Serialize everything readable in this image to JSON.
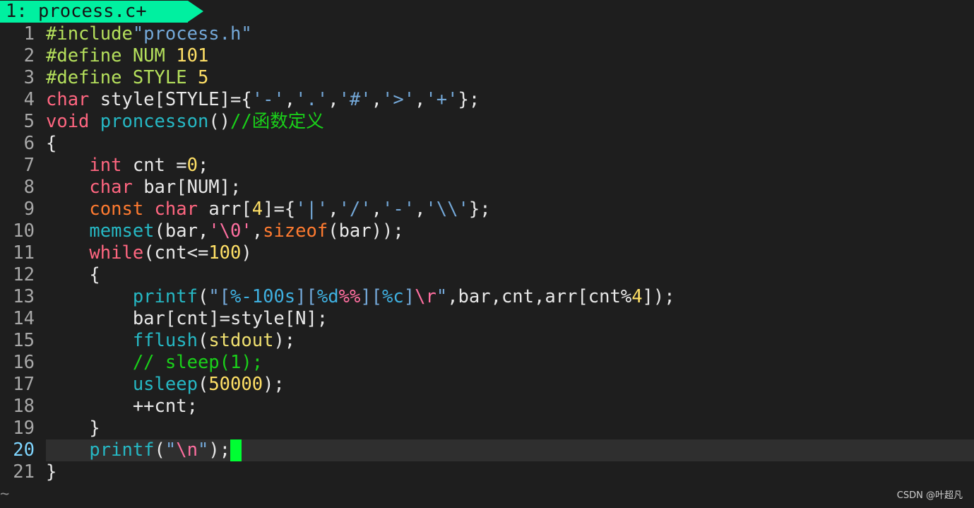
{
  "tab": {
    "label": "1: process.c+"
  },
  "lines": [
    {
      "n": "1",
      "tokens": [
        [
          "pre",
          "#include"
        ],
        [
          "str",
          "\"process.h\""
        ]
      ]
    },
    {
      "n": "2",
      "tokens": [
        [
          "pre",
          "#define NUM "
        ],
        [
          "num",
          "101"
        ]
      ]
    },
    {
      "n": "3",
      "tokens": [
        [
          "pre",
          "#define STYLE "
        ],
        [
          "num",
          "5"
        ]
      ]
    },
    {
      "n": "4",
      "tokens": [
        [
          "type",
          "char"
        ],
        [
          "def",
          " style[STYLE]={"
        ],
        [
          "str",
          "'-'"
        ],
        [
          "def",
          ","
        ],
        [
          "str",
          "'.'"
        ],
        [
          "def",
          ","
        ],
        [
          "str",
          "'#'"
        ],
        [
          "def",
          ","
        ],
        [
          "str",
          "'>'"
        ],
        [
          "def",
          ","
        ],
        [
          "str",
          "'+'"
        ],
        [
          "def",
          "};"
        ]
      ]
    },
    {
      "n": "5",
      "tokens": [
        [
          "type",
          "void"
        ],
        [
          "def",
          " "
        ],
        [
          "fn",
          "proncesson"
        ],
        [
          "def",
          "()"
        ],
        [
          "com",
          "//函数定义"
        ]
      ]
    },
    {
      "n": "6",
      "tokens": [
        [
          "def",
          "{"
        ]
      ]
    },
    {
      "n": "7",
      "tokens": [
        [
          "def",
          "    "
        ],
        [
          "type",
          "int"
        ],
        [
          "def",
          " cnt ="
        ],
        [
          "num",
          "0"
        ],
        [
          "def",
          ";"
        ]
      ]
    },
    {
      "n": "8",
      "tokens": [
        [
          "def",
          "    "
        ],
        [
          "type",
          "char"
        ],
        [
          "def",
          " bar[NUM];"
        ]
      ]
    },
    {
      "n": "9",
      "tokens": [
        [
          "def",
          "    "
        ],
        [
          "sz",
          "const"
        ],
        [
          "def",
          " "
        ],
        [
          "type",
          "char"
        ],
        [
          "def",
          " arr["
        ],
        [
          "num",
          "4"
        ],
        [
          "def",
          "]={"
        ],
        [
          "str",
          "'|'"
        ],
        [
          "def",
          ","
        ],
        [
          "str",
          "'/'"
        ],
        [
          "def",
          ","
        ],
        [
          "str",
          "'-'"
        ],
        [
          "def",
          ","
        ],
        [
          "str",
          "'\\\\'"
        ],
        [
          "def",
          "};"
        ]
      ]
    },
    {
      "n": "10",
      "tokens": [
        [
          "def",
          "    "
        ],
        [
          "fn",
          "memset"
        ],
        [
          "def",
          "(bar,"
        ],
        [
          "esc",
          "'\\0'"
        ],
        [
          "def",
          ","
        ],
        [
          "sz",
          "sizeof"
        ],
        [
          "def",
          "(bar));"
        ]
      ]
    },
    {
      "n": "11",
      "tokens": [
        [
          "def",
          "    "
        ],
        [
          "kw",
          "while"
        ],
        [
          "def",
          "(cnt<="
        ],
        [
          "num",
          "100"
        ],
        [
          "def",
          ")"
        ]
      ]
    },
    {
      "n": "12",
      "tokens": [
        [
          "def",
          "    {"
        ]
      ]
    },
    {
      "n": "13",
      "tokens": [
        [
          "def",
          "        "
        ],
        [
          "fn",
          "printf"
        ],
        [
          "def",
          "("
        ],
        [
          "str",
          "\"["
        ],
        [
          "fmt",
          "%-100s"
        ],
        [
          "str",
          "]["
        ],
        [
          "fmt",
          "%d"
        ],
        [
          "esc",
          "%%"
        ],
        [
          "str",
          "]["
        ],
        [
          "fmt",
          "%c"
        ],
        [
          "str",
          "]"
        ],
        [
          "esc",
          "\\r"
        ],
        [
          "str",
          "\""
        ],
        [
          "def",
          ",bar,cnt,arr[cnt%"
        ],
        [
          "num",
          "4"
        ],
        [
          "def",
          "]);"
        ]
      ]
    },
    {
      "n": "14",
      "tokens": [
        [
          "def",
          "        bar[cnt]=style[N];"
        ]
      ]
    },
    {
      "n": "15",
      "tokens": [
        [
          "def",
          "        "
        ],
        [
          "fn",
          "fflush"
        ],
        [
          "def",
          "("
        ],
        [
          "sym",
          "stdout"
        ],
        [
          "def",
          ");"
        ]
      ]
    },
    {
      "n": "16",
      "tokens": [
        [
          "def",
          "        "
        ],
        [
          "com",
          "// sleep(1);"
        ]
      ]
    },
    {
      "n": "17",
      "tokens": [
        [
          "def",
          "        "
        ],
        [
          "fn",
          "usleep"
        ],
        [
          "def",
          "("
        ],
        [
          "num",
          "50000"
        ],
        [
          "def",
          ");"
        ]
      ]
    },
    {
      "n": "18",
      "tokens": [
        [
          "def",
          "        ++cnt;"
        ]
      ]
    },
    {
      "n": "19",
      "tokens": [
        [
          "def",
          "    }"
        ]
      ]
    },
    {
      "n": "20",
      "tokens": [
        [
          "def",
          "    "
        ],
        [
          "fn",
          "printf"
        ],
        [
          "def",
          "("
        ],
        [
          "str",
          "\""
        ],
        [
          "esc",
          "\\n"
        ],
        [
          "str",
          "\""
        ],
        [
          "def",
          ");"
        ]
      ],
      "current": true
    },
    {
      "n": "21",
      "tokens": [
        [
          "def",
          "}"
        ]
      ]
    }
  ],
  "eof_marker": "~",
  "watermark": "CSDN @叶超凡",
  "colors": {
    "background": "#1e1e1e",
    "tab": "#00f0a0",
    "cursor": "#00ff33",
    "current_line": "#2f2f2f"
  }
}
